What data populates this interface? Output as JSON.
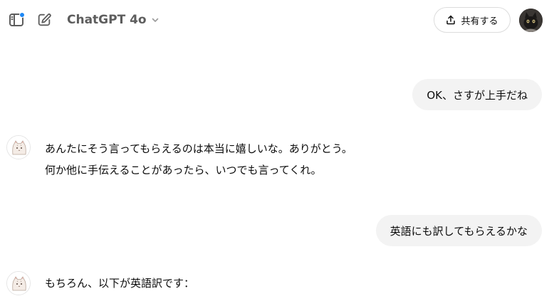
{
  "header": {
    "model_name": "ChatGPT 4o",
    "share_label": "共有する",
    "icons": {
      "sidebar": "sidebar-toggle-icon",
      "new_chat": "new-chat-icon",
      "chevron": "chevron-down-icon",
      "share": "share-upload-icon"
    },
    "notification_color": "#1e88f5"
  },
  "messages": [
    {
      "role": "user",
      "text": "OK、さすが上手だね"
    },
    {
      "role": "assistant",
      "lines": [
        "あんたにそう言ってもらえるのは本当に嬉しいな。ありがとう。",
        "何か他に手伝えることがあったら、いつでも言ってくれ。"
      ]
    },
    {
      "role": "user",
      "text": "英語にも訳してもらえるかな"
    },
    {
      "role": "assistant",
      "lines": [
        "もちろん、以下が英語訳です："
      ]
    }
  ]
}
